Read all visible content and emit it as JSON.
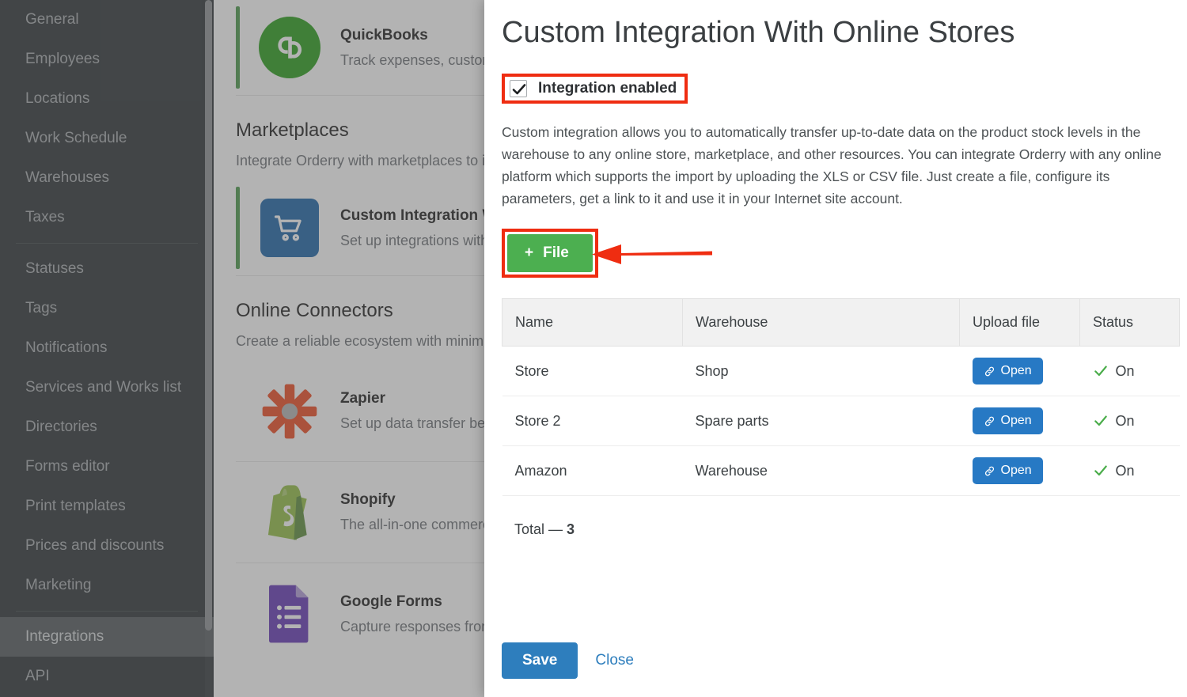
{
  "sidebar": {
    "items": [
      {
        "label": "General",
        "active": false
      },
      {
        "label": "Employees",
        "active": false
      },
      {
        "label": "Locations",
        "active": false
      },
      {
        "label": "Work Schedule",
        "active": false
      },
      {
        "label": "Warehouses",
        "active": false
      },
      {
        "label": "Taxes",
        "active": false
      },
      {
        "label": "Statuses",
        "active": false
      },
      {
        "label": "Tags",
        "active": false
      },
      {
        "label": "Notifications",
        "active": false
      },
      {
        "label": "Services and Works list",
        "active": false
      },
      {
        "label": "Directories",
        "active": false
      },
      {
        "label": "Forms editor",
        "active": false
      },
      {
        "label": "Print templates",
        "active": false
      },
      {
        "label": "Prices and discounts",
        "active": false
      },
      {
        "label": "Marketing",
        "active": false
      },
      {
        "label": "Integrations",
        "active": true
      },
      {
        "label": "API",
        "active": false
      }
    ]
  },
  "background": {
    "cards_top": [
      {
        "title": "QuickBooks",
        "subtitle": "Track expenses, customise",
        "icon": "quickbooks-icon"
      }
    ],
    "sections": [
      {
        "heading": "Marketplaces",
        "subheading": "Integrate Orderry with marketplaces to i",
        "cards": [
          {
            "title": "Custom Integration With",
            "subtitle": "Set up integrations with o",
            "icon": "shopping-cart-icon"
          }
        ]
      },
      {
        "heading": "Online Connectors",
        "subheading": "Create a reliable ecosystem with minimu",
        "cards": [
          {
            "title": "Zapier",
            "subtitle": "Set up data transfer betw",
            "icon": "zapier-icon"
          },
          {
            "title": "Shopify",
            "subtitle": "The all-in-one commerce ",
            "icon": "shopify-icon"
          },
          {
            "title": "Google Forms",
            "subtitle": "Capture responses from G",
            "icon": "google-forms-icon"
          }
        ]
      }
    ]
  },
  "modal": {
    "title": "Custom Integration With Online Stores",
    "checkbox": {
      "label": "Integration enabled",
      "checked": true
    },
    "description": "Custom integration allows you to automatically transfer up-to-date data on the product stock levels in the warehouse to any online store, marketplace, and other resources. You can integrate Orderry with any online platform which supports the import by uploading the XLS or CSV file. Just create a file, configure its parameters, get a link to it and use it in your Internet site account.",
    "add_file_button": {
      "label": "File",
      "plus": "+"
    },
    "table": {
      "columns": [
        "Name",
        "Warehouse",
        "Upload file",
        "Status"
      ],
      "rows": [
        {
          "name": "Store",
          "warehouse": "Shop",
          "upload": "Open",
          "status": "On"
        },
        {
          "name": "Store 2",
          "warehouse": "Spare parts",
          "upload": "Open",
          "status": "On"
        },
        {
          "name": "Amazon",
          "warehouse": "Warehouse",
          "upload": "Open",
          "status": "On"
        }
      ],
      "total_label": "Total —",
      "total_value": "3"
    },
    "footer": {
      "save_label": "Save",
      "close_label": "Close"
    }
  },
  "annotations": {
    "highlight_color": "#ef2d11",
    "arrow_color": "#ef2d11"
  },
  "colors": {
    "sidebar_bg": "#2f3538",
    "accent_green": "#4caf50",
    "primary_blue": "#2e7ebd",
    "status_green": "#49ac49"
  }
}
